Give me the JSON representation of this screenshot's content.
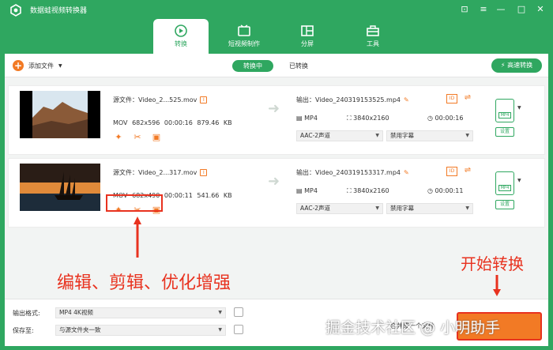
{
  "app": {
    "title": "数据蛙视频转换器"
  },
  "window_controls": {
    "feedback": "⊡",
    "menu": "≡",
    "minimize": "—",
    "maximize": "□",
    "close": "✕"
  },
  "tabs": [
    {
      "label": "转换",
      "icon": "convert-icon",
      "active": true
    },
    {
      "label": "短视频制作",
      "icon": "video-maker-icon",
      "active": false
    },
    {
      "label": "分屏",
      "icon": "split-screen-icon",
      "active": false
    },
    {
      "label": "工具",
      "icon": "toolbox-icon",
      "active": false
    }
  ],
  "toolbar": {
    "add_file": "添加文件",
    "segment_converting": "转换中",
    "segment_converted": "已转换",
    "speed_button": "高速转换"
  },
  "files": [
    {
      "source_label": "源文件：",
      "source_name": "Video_2...525.mov",
      "format": "MOV",
      "resolution": "682x596",
      "duration": "00:00:16",
      "size": "879.46 KB",
      "output_label": "输出：",
      "output_name": "Video_240319153525.mp4",
      "out_format": "MP4",
      "out_resolution": "3840x2160",
      "out_duration": "00:00:16",
      "audio": "AAC-2声道",
      "subtitle": "禁用字幕",
      "settings": "设置"
    },
    {
      "source_label": "源文件：",
      "source_name": "Video_2...317.mov",
      "format": "MOV",
      "resolution": "682x490",
      "duration": "00:00:11",
      "size": "541.66 KB",
      "output_label": "输出：",
      "output_name": "Video_240319153317.mp4",
      "out_format": "MP4",
      "out_resolution": "3840x2160",
      "out_duration": "00:00:11",
      "audio": "AAC-2声道",
      "subtitle": "禁用字幕",
      "settings": "设置"
    }
  ],
  "annotations": {
    "edit_enhance": "编辑、剪辑、优化增强",
    "start_convert": "开始转换"
  },
  "bottom": {
    "output_format_label": "输出格式:",
    "output_format_value": "MP4 4K视频",
    "save_to_label": "保存至:",
    "save_to_value": "与源文件夹一致",
    "merge_label": "合并成一个文件"
  },
  "watermark": "掘金技术社区 @ 小明助手",
  "colors": {
    "brand_green": "#2fa760",
    "accent_orange": "#f27a25",
    "annotation_red": "#e8321f"
  }
}
